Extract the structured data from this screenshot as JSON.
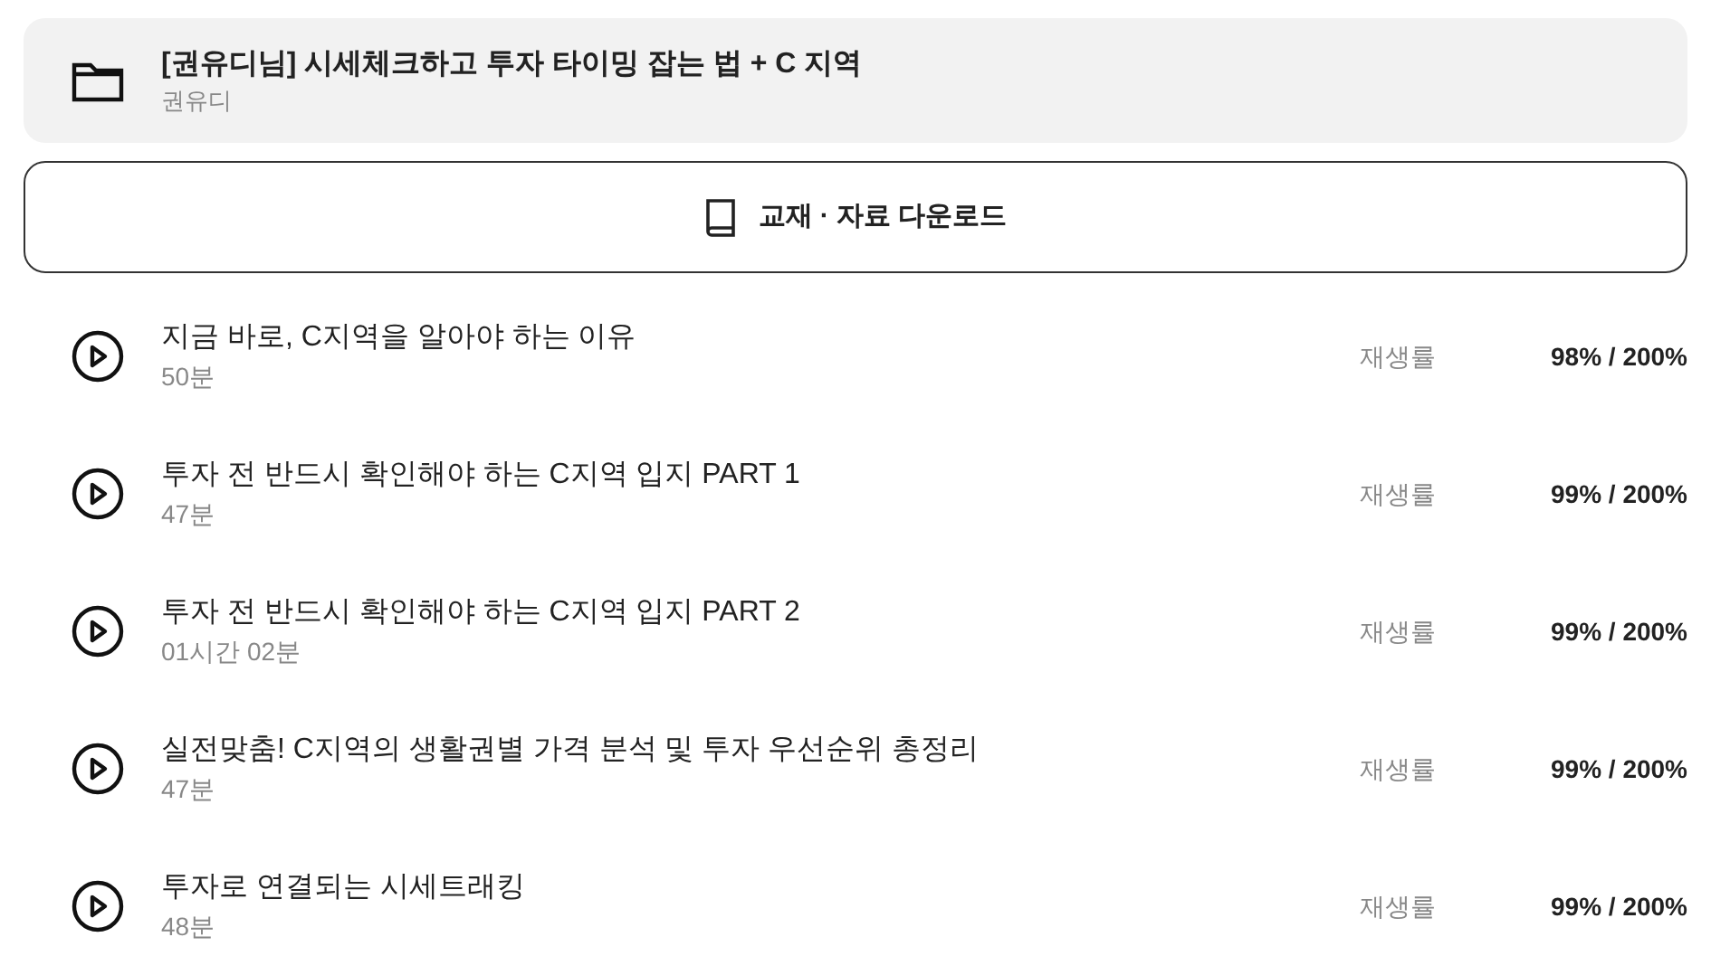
{
  "course": {
    "title": "[권유디님] 시세체크하고 투자 타이밍 잡는 법 + C 지역",
    "instructor": "권유디"
  },
  "download_button": {
    "label": "교재 · 자료 다운로드"
  },
  "lessons": [
    {
      "title": "지금 바로, C지역을 알아야 하는 이유",
      "duration": "50분",
      "rate_label": "재생률",
      "rate": "98% / 200%"
    },
    {
      "title": "투자 전 반드시 확인해야 하는 C지역 입지 PART 1",
      "duration": "47분",
      "rate_label": "재생률",
      "rate": "99% / 200%"
    },
    {
      "title": "투자 전 반드시 확인해야 하는 C지역 입지 PART 2",
      "duration": "01시간 02분",
      "rate_label": "재생률",
      "rate": "99% / 200%"
    },
    {
      "title": "실전맞춤! C지역의 생활권별 가격 분석 및 투자 우선순위 총정리",
      "duration": "47분",
      "rate_label": "재생률",
      "rate": "99% / 200%"
    },
    {
      "title": "투자로 연결되는 시세트래킹",
      "duration": "48분",
      "rate_label": "재생률",
      "rate": "99% / 200%"
    }
  ]
}
